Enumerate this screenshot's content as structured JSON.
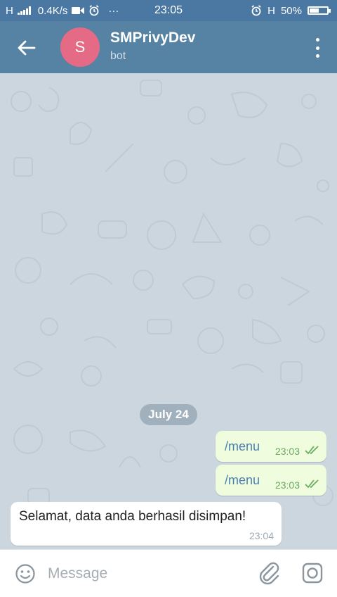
{
  "status_bar": {
    "network_label": "H",
    "speed": "0.4K/s",
    "dots": "···",
    "time": "23:05",
    "right_network": "H",
    "battery_percent": "50%",
    "battery_level": 0.5
  },
  "header": {
    "avatar_letter": "S",
    "avatar_color": "#e56a85",
    "title": "SMPrivyDev",
    "subtitle": "bot"
  },
  "chat": {
    "date_label": "July 24",
    "messages": [
      {
        "direction": "outgoing",
        "text": "/menu",
        "time": "23:03",
        "status": "read"
      },
      {
        "direction": "outgoing",
        "text": "/menu",
        "time": "23:03",
        "status": "read"
      },
      {
        "direction": "incoming",
        "text": "Selamat, data anda berhasil disimpan!",
        "time": "23:04"
      }
    ]
  },
  "input_bar": {
    "placeholder": "Message",
    "value": ""
  },
  "colors": {
    "header": "#5682a3",
    "status_bar": "#4a78a2",
    "chat_background": "#ccd6de",
    "outgoing_bubble": "#effdde",
    "read_tick": "#6aaa62"
  }
}
